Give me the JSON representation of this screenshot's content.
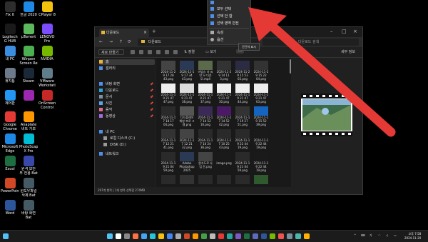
{
  "desktop_icons": [
    {
      "label": "Fix It",
      "color": "#2d2d2d"
    },
    {
      "label": "한글 2020",
      "color": "#1e88e5"
    },
    {
      "label": "CPlayer 8",
      "color": "#f4c20d"
    },
    {
      "label": "Logitech G HUB",
      "color": "#1a1a1a"
    },
    {
      "label": "µTorrent",
      "color": "#5cb85c"
    },
    {
      "label": "LENOVO Pro",
      "color": "#7c4dff"
    },
    {
      "label": "내 PC",
      "color": "#3b8de0"
    },
    {
      "label": "Winpen Screen Re",
      "color": "#4caf50"
    },
    {
      "label": "NVIDIA",
      "color": "#76b900"
    },
    {
      "label": "휴지통",
      "color": "#6c7a89"
    },
    {
      "label": "Steam",
      "color": "#1b2838"
    },
    {
      "label": "VMware Workstati",
      "color": "#607d8b"
    },
    {
      "label": "제어판",
      "color": "#2196f3"
    },
    {
      "label": "",
      "color": "#9c27b0"
    },
    {
      "label": "OnScreen Control",
      "color": "#c62828"
    },
    {
      "label": "Google Chrome",
      "color": "#e53935"
    },
    {
      "label": "Anaplate 비트 가보",
      "color": "#ff9800"
    },
    {
      "label": "Microsoft Edge",
      "color": "#1e88e5"
    },
    {
      "label": "PhotoScape X Pro",
      "color": "#00bcd4"
    },
    {
      "label": "Excel",
      "color": "#1d6f42"
    },
    {
      "label": "원격 보안 부 전용 Bat",
      "color": "#3949ab"
    },
    {
      "label": "PowerPoint",
      "color": "#d24726"
    },
    {
      "label": "원도우파일 삭제 Bat",
      "color": "#455a64"
    },
    {
      "label": "Word",
      "color": "#2b579a"
    },
    {
      "label": "바탕 화면 Bat",
      "color": "#455a64"
    }
  ],
  "explorer": {
    "tab_title": "다운로드",
    "path": "다운로드",
    "search_placeholder": "다운로드 검색",
    "new_label": "새로 만들기",
    "sort_label": "정렬",
    "view_label": "보기",
    "more_label": "…",
    "details_label": "세부 정보",
    "nav_items": [
      "홈",
      "갤러리",
      "바탕 화면",
      "다운로드",
      "문서",
      "사진",
      "음악",
      "동영상",
      "내 PC",
      "로컬 디스크 (C:)",
      "DISK (D:)",
      "네트워크"
    ],
    "status_text": "297개 항목 | 1개 항목 선택함 274MB"
  },
  "thumbnails": [
    {
      "label": "2024-11-2 9 17 28 43.png",
      "color": "#444"
    },
    {
      "label": "2024-11-1 9 17 34 43.png",
      "color": "#2a3a55"
    },
    {
      "label": "마법스 자 씨앗 모 다운 모.mp4",
      "color": "#5a6a4a"
    },
    {
      "label": "2024-11-2 9 14 11 3.png",
      "color": "#333"
    },
    {
      "label": "2024-11-2 9 15 53 03.png",
      "color": "#2b2b44"
    },
    {
      "label": "2024-11-2 9 15 22 04.png",
      "color": "#333"
    },
    {
      "label": "2024-11-1 9 21 47 47.png",
      "color": "#eee"
    },
    {
      "label": "2024-11-1 9 21 47 38.png",
      "color": "#ddd"
    },
    {
      "label": "2024-11-1 9 21 47 37.png",
      "color": "#eee"
    },
    {
      "label": "2024-11-1 9 21 47 30.png",
      "color": "#eee"
    },
    {
      "label": "2024-11-1 9 21 47 44.png",
      "color": "#eee"
    },
    {
      "label": "2024-11-1 9 21 47 03.png",
      "color": "#eee"
    },
    {
      "label": "2024-11-1 7 18 17 04.png",
      "color": "#2a2a2a"
    },
    {
      "label": "디드플레이 해방 프로 그램.png",
      "color": "#555"
    },
    {
      "label": "2024-11-1 7 14 52 16.png",
      "color": "#3a2a55"
    },
    {
      "label": "2024-11-1 7 14 52 42.png",
      "color": "#4a1a66"
    },
    {
      "label": "2024-11-1 7 19 27 51.png",
      "color": "#333"
    },
    {
      "label": "2024-11-1 9 15 52 39.png",
      "color": "#1565c0"
    },
    {
      "label": "2024-11-1 7 12 21 41.png",
      "color": "#333"
    },
    {
      "label": "2024-11-1 7 12 21 32.png",
      "color": "#444"
    },
    {
      "label": "2024-11-1 7 10 24 36.png",
      "color": "#2a2a2a"
    },
    {
      "label": "2024-11-1 7 10 25 43.png",
      "color": "#2a2a2a"
    },
    {
      "label": "2024-11-1 9 22 44 19.png",
      "color": "#2a2a2a"
    },
    {
      "label": "2024-11-1 9 22 44 19.png",
      "color": "#1a1a1a"
    },
    {
      "label": "2024-11-1 9 21 04 59.png",
      "color": "#2a2a2a"
    },
    {
      "label": "Adobe Photoshop 2025 v26.0.png",
      "color": "#2a3a55"
    },
    {
      "label": "원가도로 사업 잔.png",
      "color": "#444"
    },
    {
      "label": "image.png",
      "color": "#1a1a1a"
    },
    {
      "label": "2024-11-1 9 21 04 59.png",
      "color": "#2a2a2a"
    },
    {
      "label": "2024-11-1 9 22 44 19.png",
      "color": "#1a1a1a"
    },
    {
      "label": "",
      "color": "#2a2a2a"
    },
    {
      "label": "",
      "color": "#333"
    },
    {
      "label": "",
      "color": "#2a2a2a"
    },
    {
      "label": "",
      "color": "#2a2a2a"
    },
    {
      "label": "",
      "color": "#2a2a2a"
    },
    {
      "label": "",
      "color": "#2e5a2e"
    }
  ],
  "context_menu": {
    "items": [
      "모두 선택",
      "선택 안 함",
      "선택 영역 반전",
      "속성",
      "옵션"
    ]
  },
  "tooltip": "간단히 표시",
  "arrow_color": "#e53935",
  "taskbar": {
    "icons": [
      "#4fc3f7",
      "#ffffff",
      "#888",
      "#ff7043",
      "#42a5f5",
      "#26c6da",
      "#f4c20d",
      "#4285f4",
      "#aaa",
      "#d24726",
      "#ff9800",
      "#43a047",
      "#bbb",
      "#e53935",
      "#26a69a",
      "#7e57c2",
      "#1d6f42",
      "#5c6bc0",
      "#2b579a",
      "#76b900",
      "#ef5350",
      "#78909c",
      "#4db6ac",
      "#ffb300"
    ],
    "clock_time": "오후 7:58",
    "clock_date": "2024-11-20"
  }
}
